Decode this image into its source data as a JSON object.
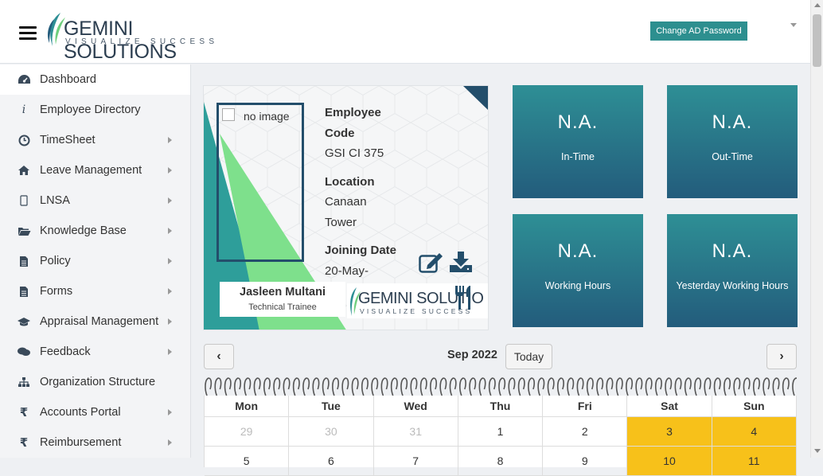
{
  "header": {
    "logo_main": "GEMINI SOLUTIONS",
    "logo_tagline": "VISUALIZE SUCCESS",
    "change_password_label": "Change AD Password"
  },
  "sidebar": {
    "items": [
      {
        "label": "Dashboard",
        "icon": "dashboard-icon",
        "active": true,
        "has_arrow": false
      },
      {
        "label": "Employee Directory",
        "icon": "info-icon",
        "has_arrow": false
      },
      {
        "label": "TimeSheet",
        "icon": "clock-icon",
        "has_arrow": true
      },
      {
        "label": "Leave Management",
        "icon": "home-icon",
        "has_arrow": true
      },
      {
        "label": "LNSA",
        "icon": "mobile-icon",
        "has_arrow": true
      },
      {
        "label": "Knowledge Base",
        "icon": "folder-open-icon",
        "has_arrow": true
      },
      {
        "label": "Policy",
        "icon": "document-icon",
        "has_arrow": true
      },
      {
        "label": "Forms",
        "icon": "document-icon",
        "has_arrow": true
      },
      {
        "label": "Appraisal Management",
        "icon": "graduation-cap-icon",
        "has_arrow": true
      },
      {
        "label": "Feedback",
        "icon": "comments-icon",
        "has_arrow": true
      },
      {
        "label": "Organization Structure",
        "icon": "sitemap-icon",
        "has_arrow": false
      },
      {
        "label": "Accounts Portal",
        "icon": "rupee-icon",
        "has_arrow": true
      },
      {
        "label": "Reimbursement",
        "icon": "rupee-icon",
        "has_arrow": true
      }
    ]
  },
  "profile": {
    "photo_alt": "no image",
    "employee_code_label": "Employee Code",
    "employee_code": "GSI CI 375",
    "location_label": "Location",
    "location": "Canaan Tower",
    "joining_date_label": "Joining Date",
    "joining_date": "20-May-",
    "name": "Jasleen Multani",
    "designation": "Technical Trainee",
    "card_logo_main": "GEMINI SOLUTIO",
    "card_logo_tagline": "VISUALIZE SUCCESS"
  },
  "stats": [
    {
      "value": "N.A.",
      "label": "In-Time"
    },
    {
      "value": "N.A.",
      "label": "Out-Time"
    },
    {
      "value": "N.A.",
      "label": "Working Hours"
    },
    {
      "value": "N.A.",
      "label": "Yesterday Working Hours"
    }
  ],
  "calendar": {
    "title": "Sep 2022",
    "today_label": "Today",
    "prev_label": "‹",
    "next_label": "›",
    "weekdays": [
      "Mon",
      "Tue",
      "Wed",
      "Thu",
      "Fri",
      "Sat",
      "Sun"
    ],
    "rows": [
      [
        "29",
        "30",
        "31",
        "1",
        "2",
        "3",
        "4"
      ],
      [
        "5",
        "6",
        "7",
        "8",
        "9",
        "10",
        "11"
      ]
    ],
    "weekend_color": "#f7c11a"
  },
  "colors": {
    "accent": "#2d8f8f",
    "tile_top": "#2e8f95",
    "tile_bottom": "#235c7c"
  }
}
